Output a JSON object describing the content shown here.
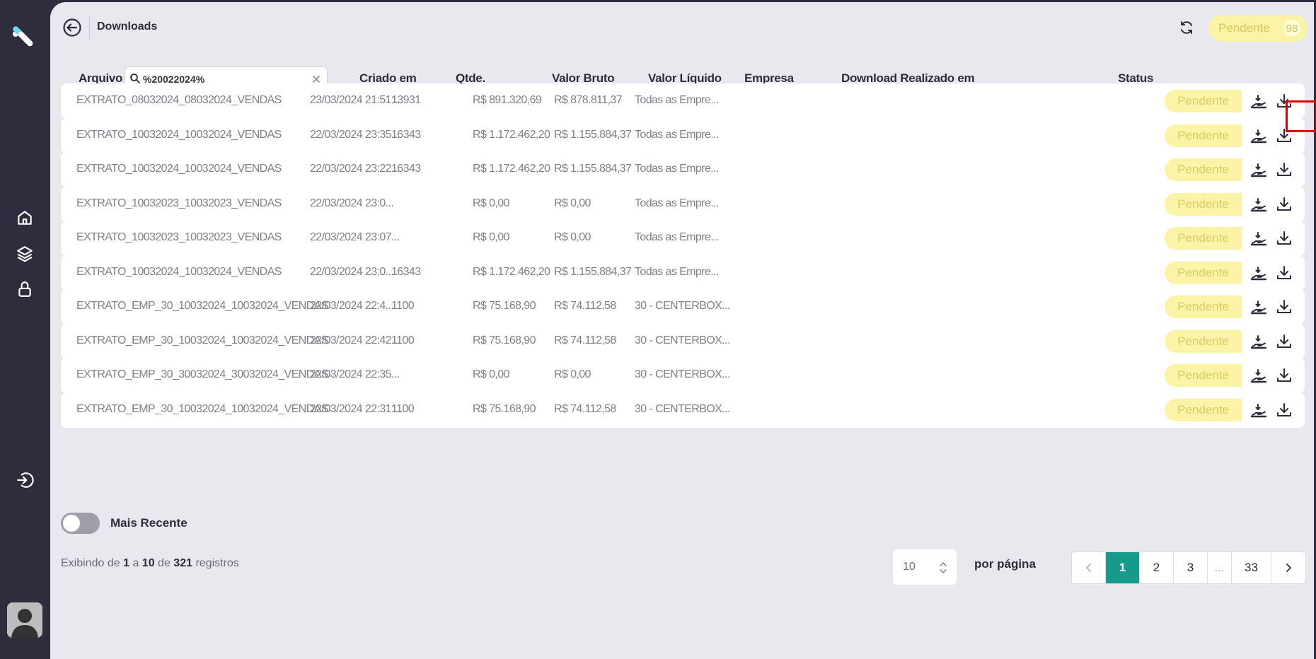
{
  "header": {
    "title": "Downloads",
    "pending_label": "Pendente",
    "pending_count": "98"
  },
  "table": {
    "columns": {
      "arquivo": "Arquivo",
      "criado": "Criado em",
      "qtde": "Qtde.",
      "bruto": "Valor Bruto",
      "liquido": "Valor Líquido",
      "empresa": "Empresa",
      "download": "Download Realizado em",
      "status": "Status"
    },
    "search_value": "%20022024%",
    "rows": [
      {
        "arquivo": "EXTRATO_08032024_08032024_VENDAS",
        "criado": "23/03/2024 21:51:...",
        "qtde": "13931",
        "bruto": "R$ 891.320,69",
        "liquido": "R$ 878.811,37",
        "empresa": "Todas as Empre...",
        "download": "",
        "status": "Pendente"
      },
      {
        "arquivo": "EXTRATO_10032024_10032024_VENDAS",
        "criado": "22/03/2024 23:35...",
        "qtde": "16343",
        "bruto": "R$ 1.172.462,20",
        "liquido": "R$ 1.155.884,37",
        "empresa": "Todas as Empre...",
        "download": "",
        "status": "Pendente"
      },
      {
        "arquivo": "EXTRATO_10032024_10032024_VENDAS",
        "criado": "22/03/2024 23:22...",
        "qtde": "16343",
        "bruto": "R$ 1.172.462,20",
        "liquido": "R$ 1.155.884,37",
        "empresa": "Todas as Empre...",
        "download": "",
        "status": "Pendente"
      },
      {
        "arquivo": "EXTRATO_10032023_10032023_VENDAS",
        "criado": "22/03/2024 23:0...",
        "qtde": "",
        "bruto": "R$ 0,00",
        "liquido": "R$ 0,00",
        "empresa": "Todas as Empre...",
        "download": "",
        "status": "Pendente"
      },
      {
        "arquivo": "EXTRATO_10032023_10032023_VENDAS",
        "criado": "22/03/2024 23:07...",
        "qtde": "",
        "bruto": "R$ 0,00",
        "liquido": "R$ 0,00",
        "empresa": "Todas as Empre...",
        "download": "",
        "status": "Pendente"
      },
      {
        "arquivo": "EXTRATO_10032024_10032024_VENDAS",
        "criado": "22/03/2024 23:0...",
        "qtde": "16343",
        "bruto": "R$ 1.172.462,20",
        "liquido": "R$ 1.155.884,37",
        "empresa": "Todas as Empre...",
        "download": "",
        "status": "Pendente"
      },
      {
        "arquivo": "EXTRATO_EMP_30_10032024_10032024_VENDAS",
        "criado": "22/03/2024 22:4...",
        "qtde": "1100",
        "bruto": "R$ 75.168,90",
        "liquido": "R$ 74.112,58",
        "empresa": "30 - CENTERBOX...",
        "download": "",
        "status": "Pendente"
      },
      {
        "arquivo": "EXTRATO_EMP_30_10032024_10032024_VENDAS",
        "criado": "22/03/2024 22:42...",
        "qtde": "1100",
        "bruto": "R$ 75.168,90",
        "liquido": "R$ 74.112,58",
        "empresa": "30 - CENTERBOX...",
        "download": "",
        "status": "Pendente"
      },
      {
        "arquivo": "EXTRATO_EMP_30_30032024_30032024_VENDAS",
        "criado": "22/03/2024 22:35...",
        "qtde": "",
        "bruto": "R$ 0,00",
        "liquido": "R$ 0,00",
        "empresa": "30 - CENTERBOX...",
        "download": "",
        "status": "Pendente"
      },
      {
        "arquivo": "EXTRATO_EMP_30_10032024_10032024_VENDAS",
        "criado": "22/03/2024 22:31:...",
        "qtde": "1100",
        "bruto": "R$ 75.168,90",
        "liquido": "R$ 74.112,58",
        "empresa": "30 - CENTERBOX...",
        "download": "",
        "status": "Pendente"
      }
    ]
  },
  "toggle": {
    "label": "Mais Recente",
    "on": false
  },
  "footer": {
    "prefix": "Exibindo de",
    "from": "1",
    "sep1": "a",
    "to": "10",
    "sep2": "de",
    "total": "321",
    "suffix": "registros",
    "per_page_value": "10",
    "per_page_label": "por página"
  },
  "pagination": {
    "pages": [
      "1",
      "2",
      "3",
      "...",
      "33"
    ],
    "current": "1"
  },
  "colors": {
    "accent": "#169a8c",
    "sidebar": "#2e2d3d",
    "status_pending_bg": "#fbf3a5",
    "highlight": "#e00000"
  }
}
